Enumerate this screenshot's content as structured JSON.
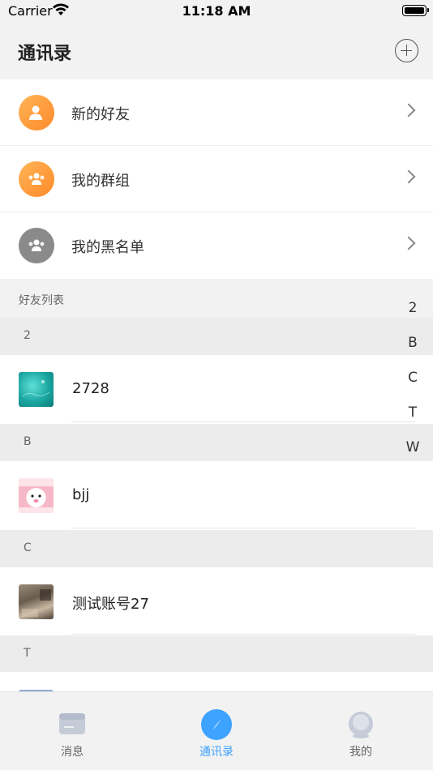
{
  "status_bar": {
    "carrier": "Carrier",
    "time": "11:18 AM"
  },
  "header": {
    "title": "通讯录"
  },
  "menu": [
    {
      "label": "新的好友",
      "icon": "add-friend-icon",
      "color": "#ff9a3c"
    },
    {
      "label": "我的群组",
      "icon": "group-icon",
      "color": "#ff9a3c"
    },
    {
      "label": "我的黑名单",
      "icon": "blacklist-icon",
      "color": "#8a8a8a"
    }
  ],
  "friends_list_title": "好友列表",
  "sections": [
    {
      "letter": "2",
      "contacts": [
        {
          "name": "2728",
          "avatar": "ocean-photo"
        }
      ]
    },
    {
      "letter": "B",
      "contacts": [
        {
          "name": "bjj",
          "avatar": "pink-cartoon"
        }
      ]
    },
    {
      "letter": "C",
      "contacts": [
        {
          "name": "测试账号27",
          "avatar": "room-photo"
        }
      ]
    },
    {
      "letter": "T",
      "contacts": []
    }
  ],
  "index_letters": [
    "2",
    "B",
    "C",
    "T",
    "W"
  ],
  "tabs": [
    {
      "label": "消息",
      "icon": "message-icon",
      "active": false
    },
    {
      "label": "通讯录",
      "icon": "compass-icon",
      "active": true
    },
    {
      "label": "我的",
      "icon": "profile-icon",
      "active": false
    }
  ],
  "colors": {
    "accent": "#3ea2ff",
    "orange": "#ff9a3c"
  }
}
